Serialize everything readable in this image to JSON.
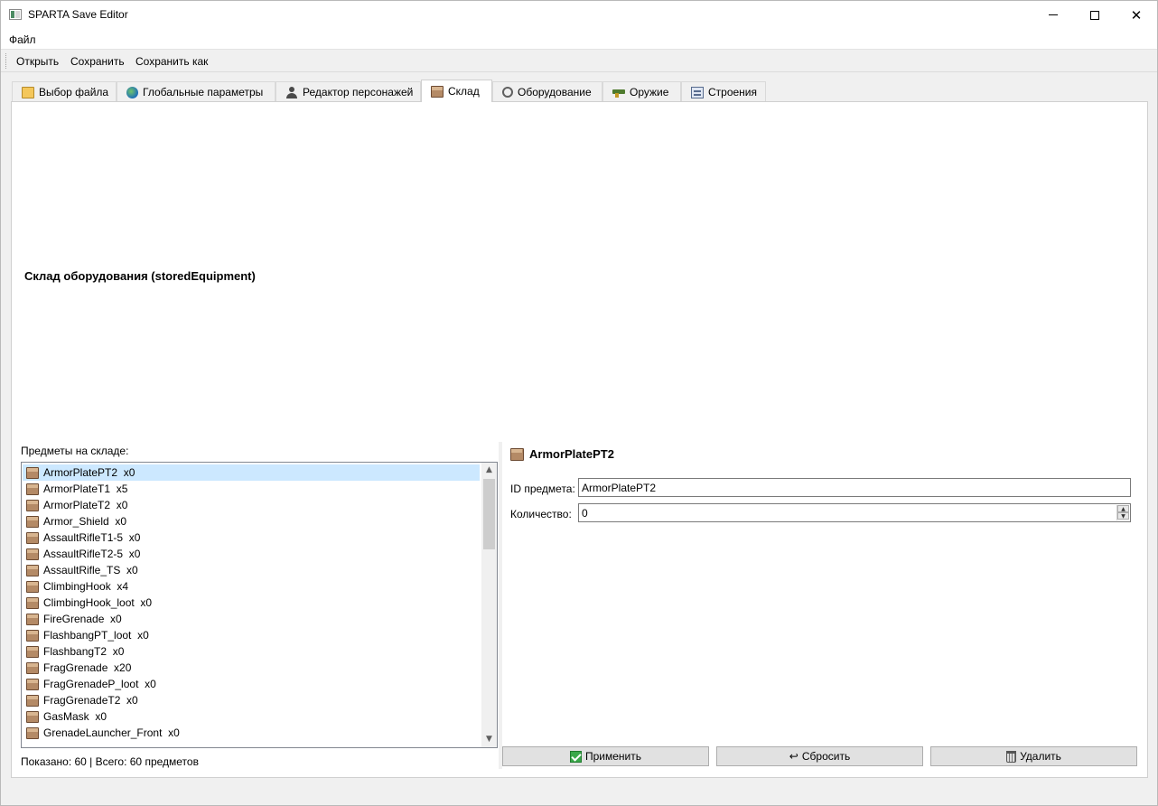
{
  "window": {
    "title": "SPARTA Save Editor"
  },
  "menu": {
    "file": "Файл"
  },
  "toolbar": {
    "open": "Открыть",
    "save": "Сохранить",
    "save_as": "Сохранить как"
  },
  "tabs": [
    {
      "label": "Выбор файла",
      "icon": "folder-icon"
    },
    {
      "label": "Глобальные параметры",
      "icon": "globe-icon"
    },
    {
      "label": "Редактор персонажей",
      "icon": "person-icon"
    },
    {
      "label": "Склад",
      "icon": "box-icon",
      "active": true
    },
    {
      "label": "Оборудование",
      "icon": "gear-icon"
    },
    {
      "label": "Оружие",
      "icon": "gun-icon"
    },
    {
      "label": "Строения",
      "icon": "building-icon"
    }
  ],
  "storage": {
    "section_title": "Склад оборудования (storedEquipment)",
    "list_label": "Предметы на складе:",
    "items": [
      "ArmorPlatePT2  x0",
      "ArmorPlateT1  x5",
      "ArmorPlateT2  x0",
      "Armor_Shield  x0",
      "AssaultRifleT1-5  x0",
      "AssaultRifleT2-5  x0",
      "AssaultRifle_TS  x0",
      "ClimbingHook  x4",
      "ClimbingHook_loot  x0",
      "FireGrenade  x0",
      "FlashbangPT_loot  x0",
      "FlashbangT2  x0",
      "FragGrenade  x20",
      "FragGrenadeP_loot  x0",
      "FragGrenadeT2  x0",
      "GasMask  x0",
      "GrenadeLauncher_Front  x0"
    ],
    "status": "Показано: 60 | Всего: 60 предметов"
  },
  "detail": {
    "title": "ArmorPlatePT2",
    "id_label": "ID предмета:",
    "id_value": "ArmorPlatePT2",
    "qty_label": "Количество:",
    "qty_value": "0",
    "apply": "Применить",
    "reset": "Сбросить",
    "delete": "Удалить"
  }
}
